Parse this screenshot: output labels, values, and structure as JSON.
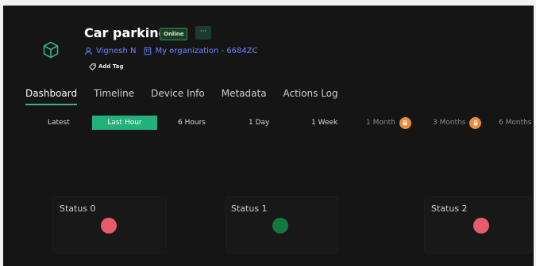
{
  "device": {
    "title": "Car parking",
    "status_badge": "Online",
    "more_label": "···",
    "owner": "Vignesh N",
    "organization": "My organization - 6684ZC",
    "add_tag_label": "Add Tag"
  },
  "tabs": [
    "Dashboard",
    "Timeline",
    "Device Info",
    "Metadata",
    "Actions Log"
  ],
  "active_tab": "Dashboard",
  "time_ranges": [
    {
      "label": "Latest",
      "locked": false
    },
    {
      "label": "Last Hour",
      "locked": false,
      "active": true
    },
    {
      "label": "6 Hours",
      "locked": false
    },
    {
      "label": "1 Day",
      "locked": false
    },
    {
      "label": "1 Week",
      "locked": false
    },
    {
      "label": "1 Month",
      "locked": true
    },
    {
      "label": "3 Months",
      "locked": true
    },
    {
      "label": "6 Months",
      "locked": false
    }
  ],
  "status_widgets": [
    {
      "label": "Status 0",
      "state_color": "#e45c6e"
    },
    {
      "label": "Status 1",
      "state_color": "#137a3f"
    },
    {
      "label": "Status 2",
      "state_color": "#e45c6e"
    }
  ],
  "colors": {
    "accent": "#24b07a",
    "link": "#6b84ff",
    "lock_badge": "#f08a3a"
  }
}
